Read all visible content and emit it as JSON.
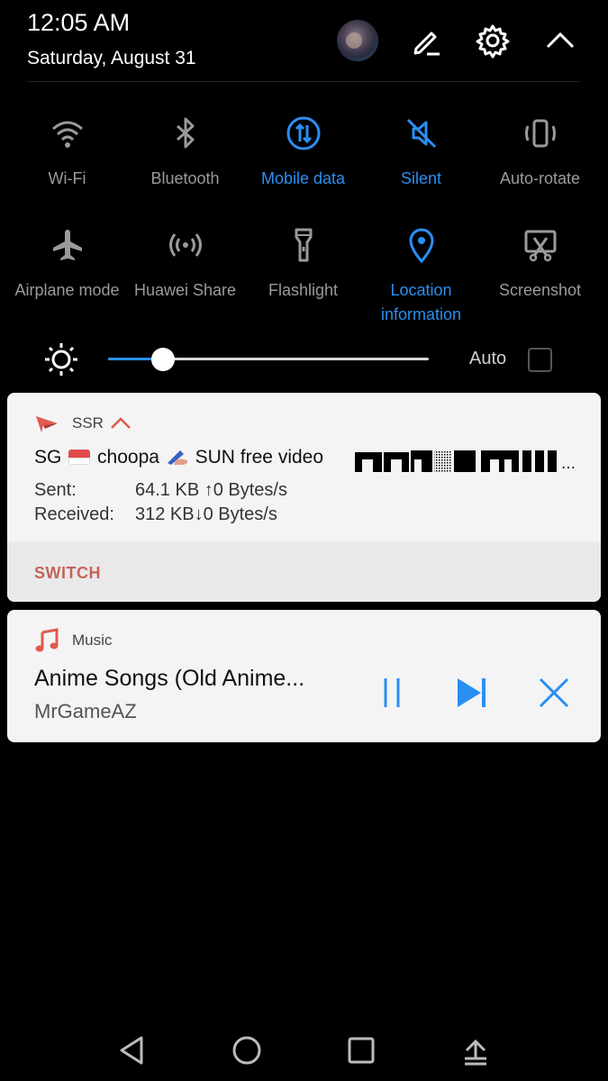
{
  "status": {
    "time": "12:05 AM",
    "date": "Saturday, August 31"
  },
  "header_icons": [
    "avatar",
    "edit-icon",
    "settings-icon",
    "chevron-up-icon"
  ],
  "toggles": [
    {
      "label": "Wi-Fi",
      "icon": "wifi-icon",
      "active": false
    },
    {
      "label": "Bluetooth",
      "icon": "bluetooth-icon",
      "active": false
    },
    {
      "label": "Mobile data",
      "icon": "mobile-data-icon",
      "active": true
    },
    {
      "label": "Silent",
      "icon": "silent-icon",
      "active": true
    },
    {
      "label": "Auto-rotate",
      "icon": "auto-rotate-icon",
      "active": false
    },
    {
      "label": "Airplane mode",
      "icon": "airplane-icon",
      "active": false
    },
    {
      "label": "Huawei Share",
      "icon": "huawei-share-icon",
      "active": false
    },
    {
      "label": "Flashlight",
      "icon": "flashlight-icon",
      "active": false
    },
    {
      "label": "Location information",
      "icon": "location-icon",
      "active": true
    },
    {
      "label": "Screenshot",
      "icon": "screenshot-icon",
      "active": false
    }
  ],
  "brightness": {
    "level": 0.17,
    "auto_label": "Auto",
    "auto_checked": false
  },
  "ssr_notification": {
    "app_name": "SSR",
    "server_prefix": "SG",
    "server_name": "choopa",
    "server_suffix": "SUN free video",
    "sent_label": "Sent:",
    "sent_value": "64.1 KB",
    "sent_rate": "↑0 Bytes/s",
    "received_label": "Received:",
    "received_value": "312 KB",
    "received_rate": "↓0 Bytes/s",
    "action_label": "SWITCH"
  },
  "music_notification": {
    "app_name": "Music",
    "title": "Anime Songs (Old Anime...",
    "artist": "MrGameAZ",
    "controls": [
      "pause-icon",
      "next-icon",
      "close-icon"
    ]
  },
  "colors": {
    "accent": "#2a8ff2",
    "inactive": "#9a9a9a",
    "switch_red": "#c4645a",
    "ssr_red": "#e05a50"
  },
  "nav": [
    "back-icon",
    "home-icon",
    "recents-icon",
    "notification-shade-icon"
  ]
}
